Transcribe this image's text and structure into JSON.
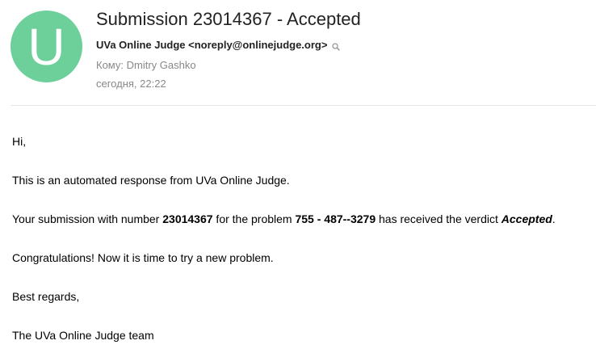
{
  "email": {
    "avatar_letter": "U",
    "avatar_color": "#6dd09b",
    "subject": "Submission 23014367 - Accepted",
    "from": "UVa Online Judge <noreply@onlinejudge.org>",
    "to": "Кому: Dmitry Gashko",
    "date": "сегодня, 22:22"
  },
  "message": {
    "greeting": "Hi,",
    "line1": "This is an automated response from UVa Online Judge.",
    "line2_prefix": "Your submission with number ",
    "submission_number": "23014367",
    "line2_middle": " for the problem ",
    "problem": "755 - 487--3279",
    "line2_suffix": " has received the verdict ",
    "verdict": "Accepted",
    "line2_end": ".",
    "line3": "Congratulations! Now it is time to try a new problem.",
    "closing": "Best regards,",
    "signature": "The UVa Online Judge team"
  }
}
